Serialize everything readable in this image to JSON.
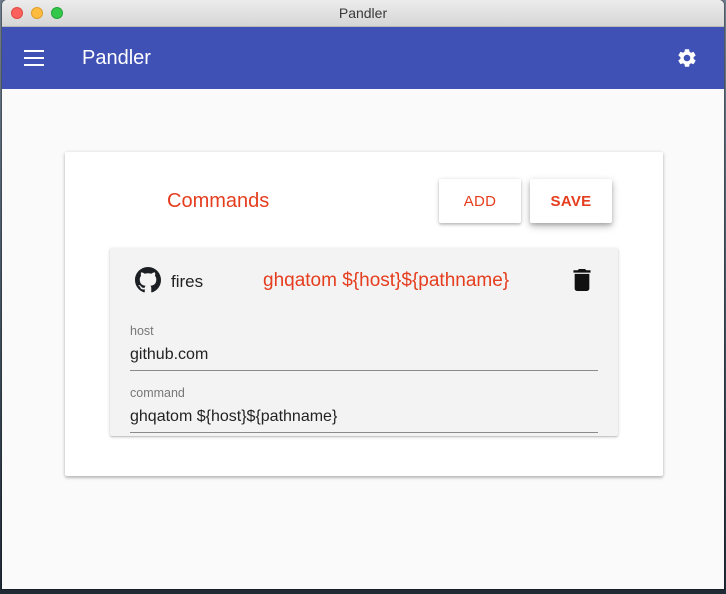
{
  "window": {
    "title": "Pandler"
  },
  "appbar": {
    "title": "Pandler",
    "menu_icon": "menu-icon",
    "settings_icon": "gear-icon"
  },
  "card": {
    "title": "Commands",
    "add_label": "ADD",
    "save_label": "SAVE",
    "items": [
      {
        "icon": "github-icon",
        "name": "fires",
        "command_display": "ghqatom ${host}${pathname}",
        "delete_icon": "trash-icon",
        "host_label": "host",
        "host_value": "github.com",
        "command_label": "command",
        "command_value": "ghqatom ${host}${pathname}"
      }
    ]
  },
  "colors": {
    "appbar": "#3f51b5",
    "accent": "#e53d1e"
  }
}
